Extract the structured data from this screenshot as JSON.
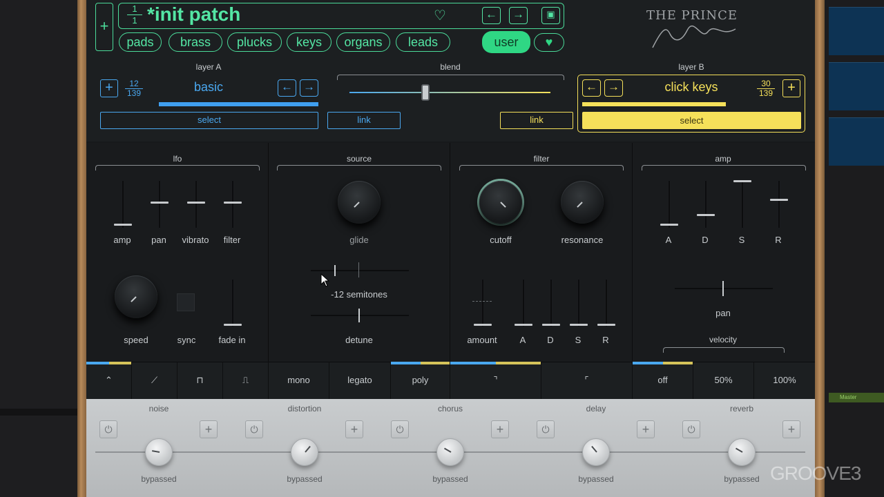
{
  "patch": {
    "counter_top": "1",
    "counter_bottom": "1",
    "name": "*init patch"
  },
  "categories": [
    "pads",
    "brass",
    "plucks",
    "keys",
    "organs",
    "leads"
  ],
  "user_label": "user",
  "brand": {
    "title": "THE PRINCE",
    "signature": "Frank Dukes"
  },
  "layer_a": {
    "title": "layer A",
    "preset": "basic",
    "index": "12",
    "total": "139",
    "select": "select",
    "link": "link"
  },
  "layer_b": {
    "title": "layer B",
    "preset": "click keys",
    "index": "30",
    "total": "139",
    "select": "select",
    "link": "link"
  },
  "blend": {
    "title": "blend"
  },
  "sections": {
    "lfo": "lfo",
    "source": "source",
    "filter": "filter",
    "amp": "amp"
  },
  "lfo": {
    "amp": "amp",
    "pan": "pan",
    "vibrato": "vibrato",
    "filter": "filter",
    "speed": "speed",
    "sync": "sync",
    "fade_in": "fade in"
  },
  "source": {
    "glide": "glide",
    "semitones": "-12 semitones",
    "detune": "detune"
  },
  "filter": {
    "cutoff": "cutoff",
    "resonance": "resonance",
    "amount": "amount",
    "a": "A",
    "d": "D",
    "s": "S",
    "r": "R"
  },
  "amp": {
    "a": "A",
    "d": "D",
    "s": "S",
    "r": "R",
    "pan": "pan",
    "velocity": "velocity"
  },
  "modes": {
    "mono": "mono",
    "legato": "legato",
    "poly": "poly",
    "off": "off",
    "p50": "50%",
    "p100": "100%"
  },
  "fx": [
    {
      "name": "noise",
      "status": "bypassed"
    },
    {
      "name": "distortion",
      "status": "bypassed"
    },
    {
      "name": "chorus",
      "status": "bypassed"
    },
    {
      "name": "delay",
      "status": "bypassed"
    },
    {
      "name": "reverb",
      "status": "bypassed"
    }
  ],
  "daw": {
    "master": "Master"
  },
  "watermark": "GROOVE3",
  "colors": {
    "green": "#4bdc9a",
    "blue": "#4aa8f0",
    "yellow": "#f5e05a"
  }
}
